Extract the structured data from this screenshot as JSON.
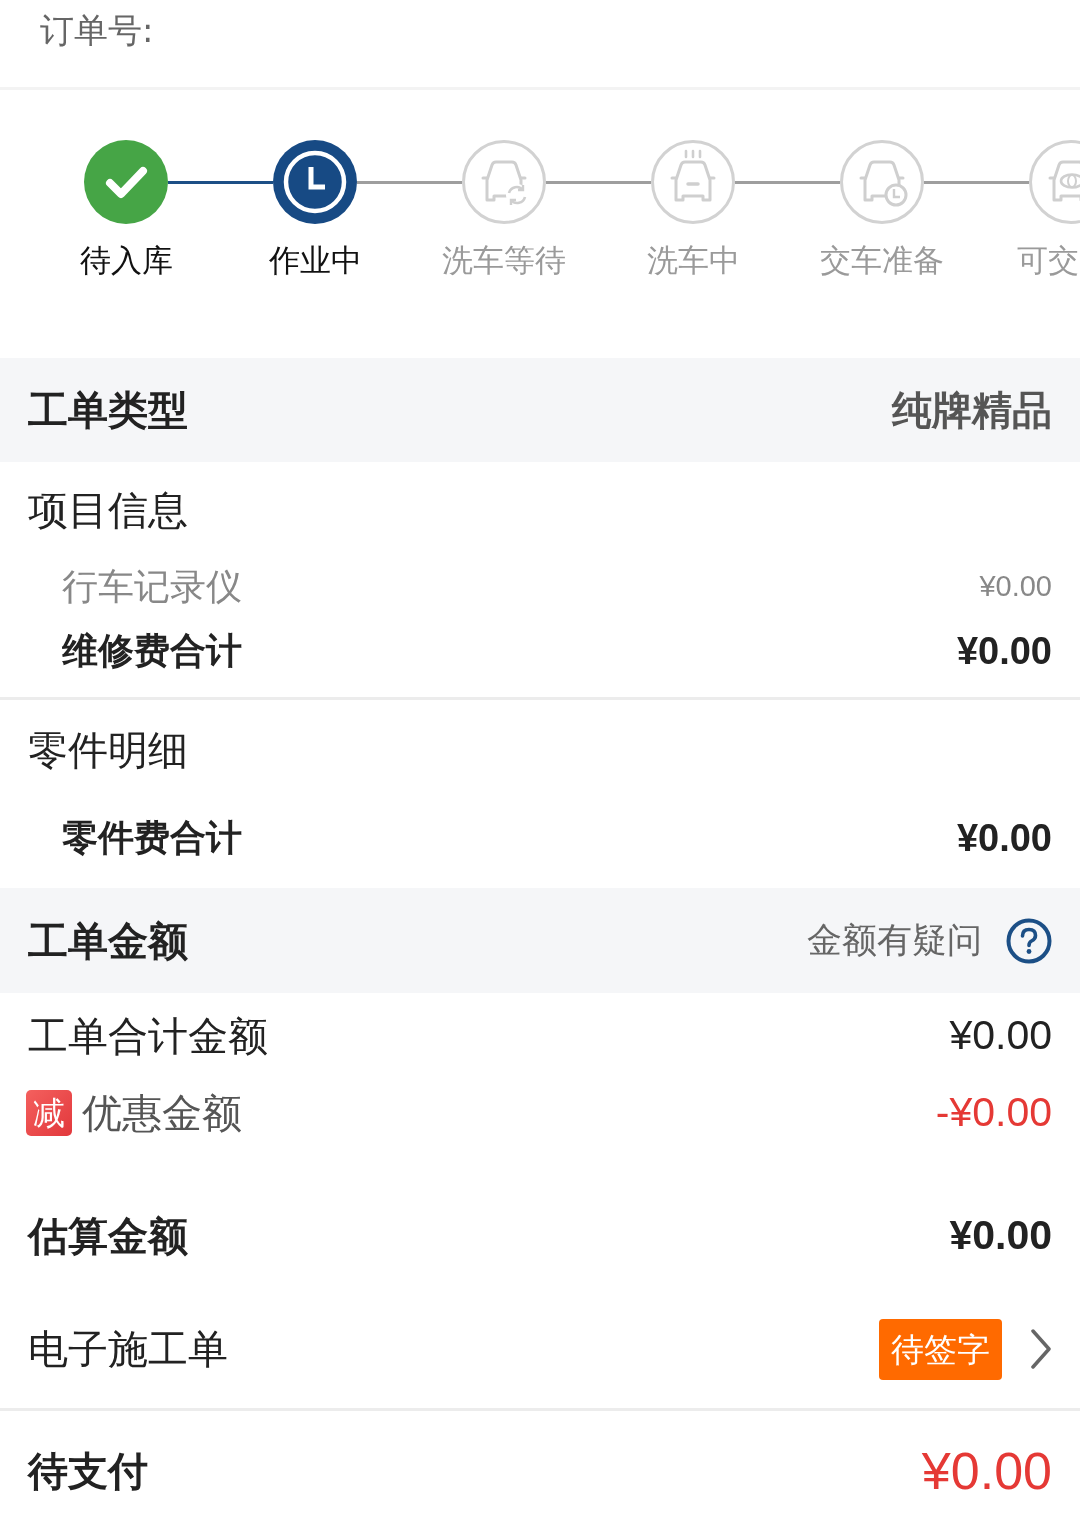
{
  "order": {
    "label": "订单号:"
  },
  "progress": {
    "steps": [
      {
        "label": "待入库",
        "done": true,
        "active": false,
        "kind": "check"
      },
      {
        "label": "作业中",
        "done": false,
        "active": true,
        "kind": "clock"
      },
      {
        "label": "洗车等待",
        "done": false,
        "active": false,
        "kind": "car-refresh"
      },
      {
        "label": "洗车中",
        "done": false,
        "active": false,
        "kind": "car-steam"
      },
      {
        "label": "交车准备",
        "done": false,
        "active": false,
        "kind": "car-clock"
      },
      {
        "label": "可交",
        "done": false,
        "active": false,
        "kind": "car-emblem"
      }
    ]
  },
  "work_order_type": {
    "title": "工单类型",
    "value": "纯牌精品"
  },
  "project_info": {
    "title": "项目信息",
    "items": [
      {
        "name": "行车记录仪",
        "amount": "¥0.00"
      }
    ],
    "subtotal": {
      "label": "维修费合计",
      "amount": "¥0.00"
    }
  },
  "parts_detail": {
    "title": "零件明细",
    "subtotal": {
      "label": "零件费合计",
      "amount": "¥0.00"
    }
  },
  "work_order_amount": {
    "title": "工单金额",
    "query_link": "金额有疑问",
    "rows": [
      {
        "kind": "plain",
        "label": "工单合计金额",
        "amount": "¥0.00"
      },
      {
        "kind": "discount",
        "tag": "减",
        "label": "优惠金额",
        "amount": "-¥0.00"
      },
      {
        "kind": "total",
        "label": "估算金额",
        "amount": "¥0.00"
      }
    ]
  },
  "e_work_order": {
    "label": "电子施工单",
    "status": "待签字"
  },
  "payment": {
    "label": "待支付",
    "amount": "¥0.00"
  }
}
